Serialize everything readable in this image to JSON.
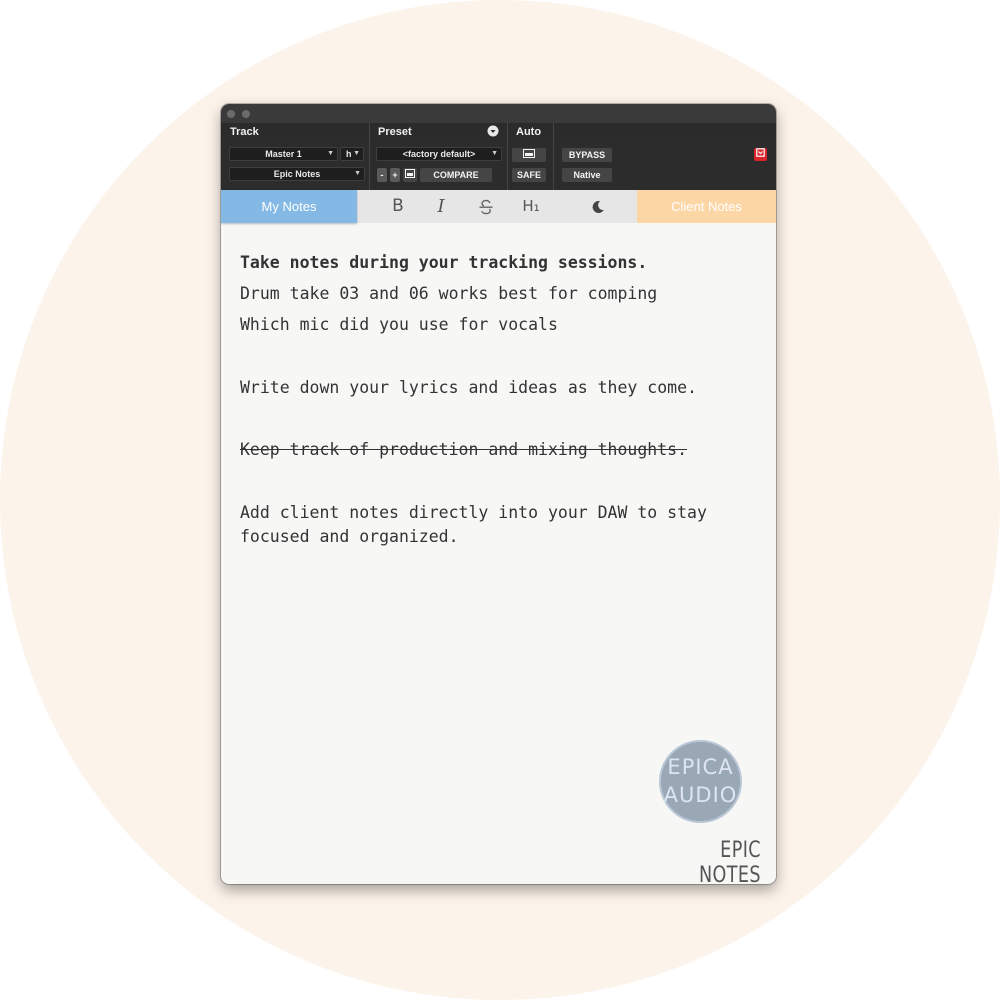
{
  "colors": {
    "background_circle": "#fcf3ea",
    "my_notes_tab": "#84b9e5",
    "client_notes_tab": "#fdd6a6",
    "bypass_red": "#d9242c"
  },
  "window_controls": [
    "close",
    "minimize"
  ],
  "plugin_header": {
    "track_label": "Track",
    "preset_label": "Preset",
    "auto_label": "Auto",
    "track_select": "Master 1",
    "track_sub": "h",
    "insert_select": "Epic Notes",
    "preset_select": "<factory default>",
    "minus_label": "-",
    "plus_label": "+",
    "compare_label": "COMPARE",
    "safe_label": "SAFE",
    "bypass_label": "BYPASS",
    "native_label": "Native"
  },
  "toolbar": {
    "my_notes_tab": "My Notes",
    "client_notes_tab": "Client Notes",
    "bold": "B",
    "italic": "I",
    "heading": "H₁"
  },
  "notes": {
    "line1": "Take notes during your tracking sessions.",
    "line2": "Drum take 03 and 06 works best for comping",
    "line3": "Which mic did you use for vocals",
    "line4": "Write down your lyrics and ideas as they come.",
    "line5": "Keep track of production and mixing thoughts.",
    "line6": "Add client notes directly into your DAW to stay focused and organized."
  },
  "branding": {
    "logo_line1": "EPICA",
    "logo_line2": "AUDIO",
    "product": "EPIC NOTES"
  }
}
